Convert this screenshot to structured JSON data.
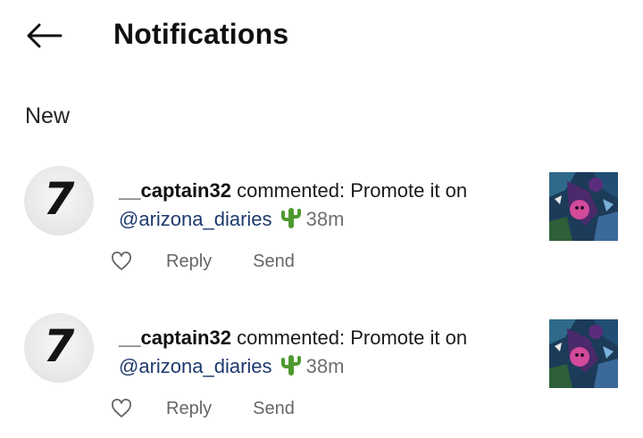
{
  "header": {
    "title": "Notifications",
    "back_icon": "arrow-left-icon"
  },
  "section": {
    "label": "New"
  },
  "notifications": [
    {
      "username": "__captain32",
      "action": " commented: Promote it on",
      "mention": "@arizona_diaries",
      "emoji": "cactus",
      "time": "38m",
      "like_icon": "heart-outline-icon",
      "reply_label": "Reply",
      "send_label": "Send"
    },
    {
      "username": "__captain32",
      "action": " commented: Promote it on",
      "mention": "@arizona_diaries",
      "emoji": "cactus",
      "time": "38m",
      "like_icon": "heart-outline-icon",
      "reply_label": "Reply",
      "send_label": "Send"
    }
  ],
  "colors": {
    "mention": "#1e3a6e",
    "muted": "#6f6f6f"
  }
}
